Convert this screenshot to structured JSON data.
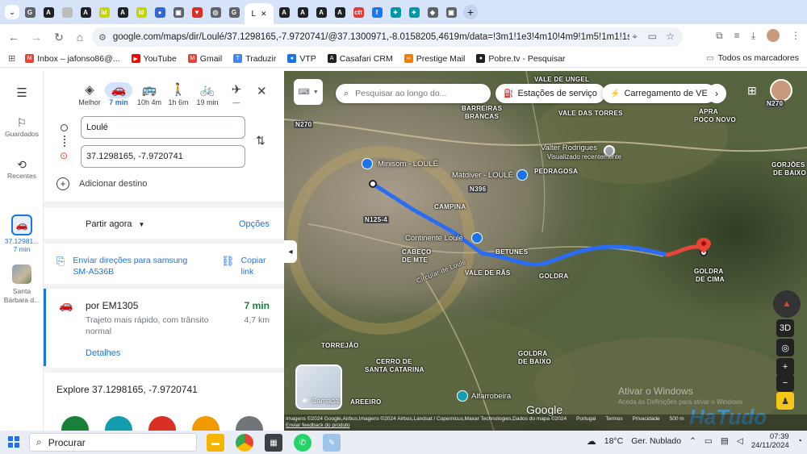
{
  "browser": {
    "tabs": [
      {
        "icon": "G",
        "color": "#5f6368"
      },
      {
        "icon": "A",
        "color": "#202124"
      },
      {
        "icon": "",
        "color": "#bdbdbd"
      },
      {
        "icon": "A",
        "color": "#202124"
      },
      {
        "icon": "id",
        "color": "#c4d600"
      },
      {
        "icon": "A",
        "color": "#202124"
      },
      {
        "icon": "id",
        "color": "#c4d600"
      },
      {
        "icon": "●",
        "color": "#3367d6"
      },
      {
        "icon": "▣",
        "color": "#5f6368"
      },
      {
        "icon": "▼",
        "color": "#d93025"
      },
      {
        "icon": "◎",
        "color": "#5f6368"
      },
      {
        "icon": "G",
        "color": "#5f6368"
      }
    ],
    "active_tab_label": "L",
    "tabs_right": [
      {
        "icon": "A",
        "color": "#202124"
      },
      {
        "icon": "A",
        "color": "#202124"
      },
      {
        "icon": "A",
        "color": "#202124"
      },
      {
        "icon": "A",
        "color": "#202124"
      },
      {
        "icon": "ctt",
        "color": "#e53935"
      },
      {
        "icon": "f",
        "color": "#1877f2"
      },
      {
        "icon": "✦",
        "color": "#0097a7"
      },
      {
        "icon": "✦",
        "color": "#0097a7"
      },
      {
        "icon": "◆",
        "color": "#5f6368"
      },
      {
        "icon": "▣",
        "color": "#5f6368"
      }
    ],
    "url": "google.com/maps/dir/Loulé/37.1298165,-7.9720741/@37.1300971,-8.0158205,4619m/data=!3m1!1e3!4m10!4m9!1m5!1m1!1s0xd1ab12...",
    "bookmarks": [
      {
        "label": "Inbox – jafonso86@...",
        "color": "#ea4335",
        "icon": "M"
      },
      {
        "label": "YouTube",
        "color": "#ff0000",
        "icon": "▶"
      },
      {
        "label": "Gmail",
        "color": "#ea4335",
        "icon": "M"
      },
      {
        "label": "Traduzir",
        "color": "#4285f4",
        "icon": "T"
      },
      {
        "label": "VTP",
        "color": "#1a73e8",
        "icon": "●"
      },
      {
        "label": "Casafari CRM",
        "color": "#202124",
        "icon": "A"
      },
      {
        "label": "Prestige Mail",
        "color": "#f57c00",
        "icon": "∞"
      },
      {
        "label": "Pobre.tv - Pesquisar",
        "color": "#202124",
        "icon": "●"
      }
    ],
    "all_bookmarks_label": "Todos os marcadores"
  },
  "rail": {
    "saved_label": "Guardados",
    "recents_label": "Recentes",
    "recent1_label": "37.12981...",
    "recent1_sub": "7 min",
    "recent2_label": "Santa Bárbara d..."
  },
  "directions": {
    "modes": [
      {
        "label": "Melhor",
        "icon": "◈",
        "selected": false
      },
      {
        "label": "7 min",
        "icon": "🚗",
        "selected": true
      },
      {
        "label": "10h 4m",
        "icon": "🚌",
        "selected": false
      },
      {
        "label": "1h 6m",
        "icon": "🚶",
        "selected": false
      },
      {
        "label": "19 min",
        "icon": "🚲",
        "selected": false
      },
      {
        "label": "—",
        "icon": "✈",
        "selected": false
      }
    ],
    "origin": "Loulé",
    "destination": "37.1298165, -7.9720741",
    "add_destination": "Adicionar destino",
    "depart_now": "Partir agora",
    "options": "Opções",
    "send_to": "Enviar direções para samsung SM-A536B",
    "copy_link": "Copiar link",
    "route": {
      "name": "por EM1305",
      "time": "7 min",
      "desc": "Trajeto mais rápido, com trânsito normal",
      "distance": "4,7 km",
      "details": "Detalhes"
    },
    "explore": "Explore 37.1298165, -7.9720741"
  },
  "map": {
    "search_placeholder": "Pesquisar ao longo do...",
    "chips": [
      "Estações de serviço",
      "Carregamento de VE"
    ],
    "places": [
      {
        "label": "Minisom - LOULÉ"
      },
      {
        "label": "Matdiver - LOULÉ"
      },
      {
        "label": "Valter Rodrigues"
      },
      {
        "label": "Visualizado recentemente"
      },
      {
        "label": "Continente Loulé"
      },
      {
        "label": "Alfarrobeira"
      }
    ],
    "area_labels": [
      "VALE DE UNGEL",
      "BARREIRAS",
      "BRANCAS",
      "APRA",
      "POÇO NOVO",
      "VALE DAS TORRES",
      "PEDRAGOSA",
      "CAMPINA",
      "CABEÇO",
      "DE MTE",
      "BETUNES",
      "VALE DE RÃS",
      "GOLDRA",
      "GOLDRA",
      "DE CIMA",
      "GORJÕES",
      "DE BAIXO",
      "TORREJÃO",
      "CERRO DE",
      "SANTA CATARINA",
      "GOLDRA",
      "DE BAIXO",
      "AREEIRO",
      "Circular de Loulé"
    ],
    "road_labels": [
      "N270",
      "N396",
      "N125-4",
      "N270"
    ],
    "layers_label": "Camadas",
    "logo": "Google",
    "attribution": "Imagens ©2024 Google,Airbus,Imagens ©2024 Airbus,Landsat / Copernicus,Maxar Technologies,Dados do mapa ©2024",
    "attr_links": [
      "Portugal",
      "Termos",
      "Privacidade"
    ],
    "scale": "500 m",
    "feedback": "Enviar feedback do produto",
    "btn_3d": "3D",
    "watermark": "Ativar o Windows",
    "watermark_sub": "Aceda às Definições para ativar o Windows.",
    "hatudo": "HaTudo"
  },
  "taskbar": {
    "search": "Procurar",
    "weather_temp": "18°C",
    "weather_desc": "Ger. Nublado",
    "time": "07:39",
    "date": "24/11/2024"
  }
}
